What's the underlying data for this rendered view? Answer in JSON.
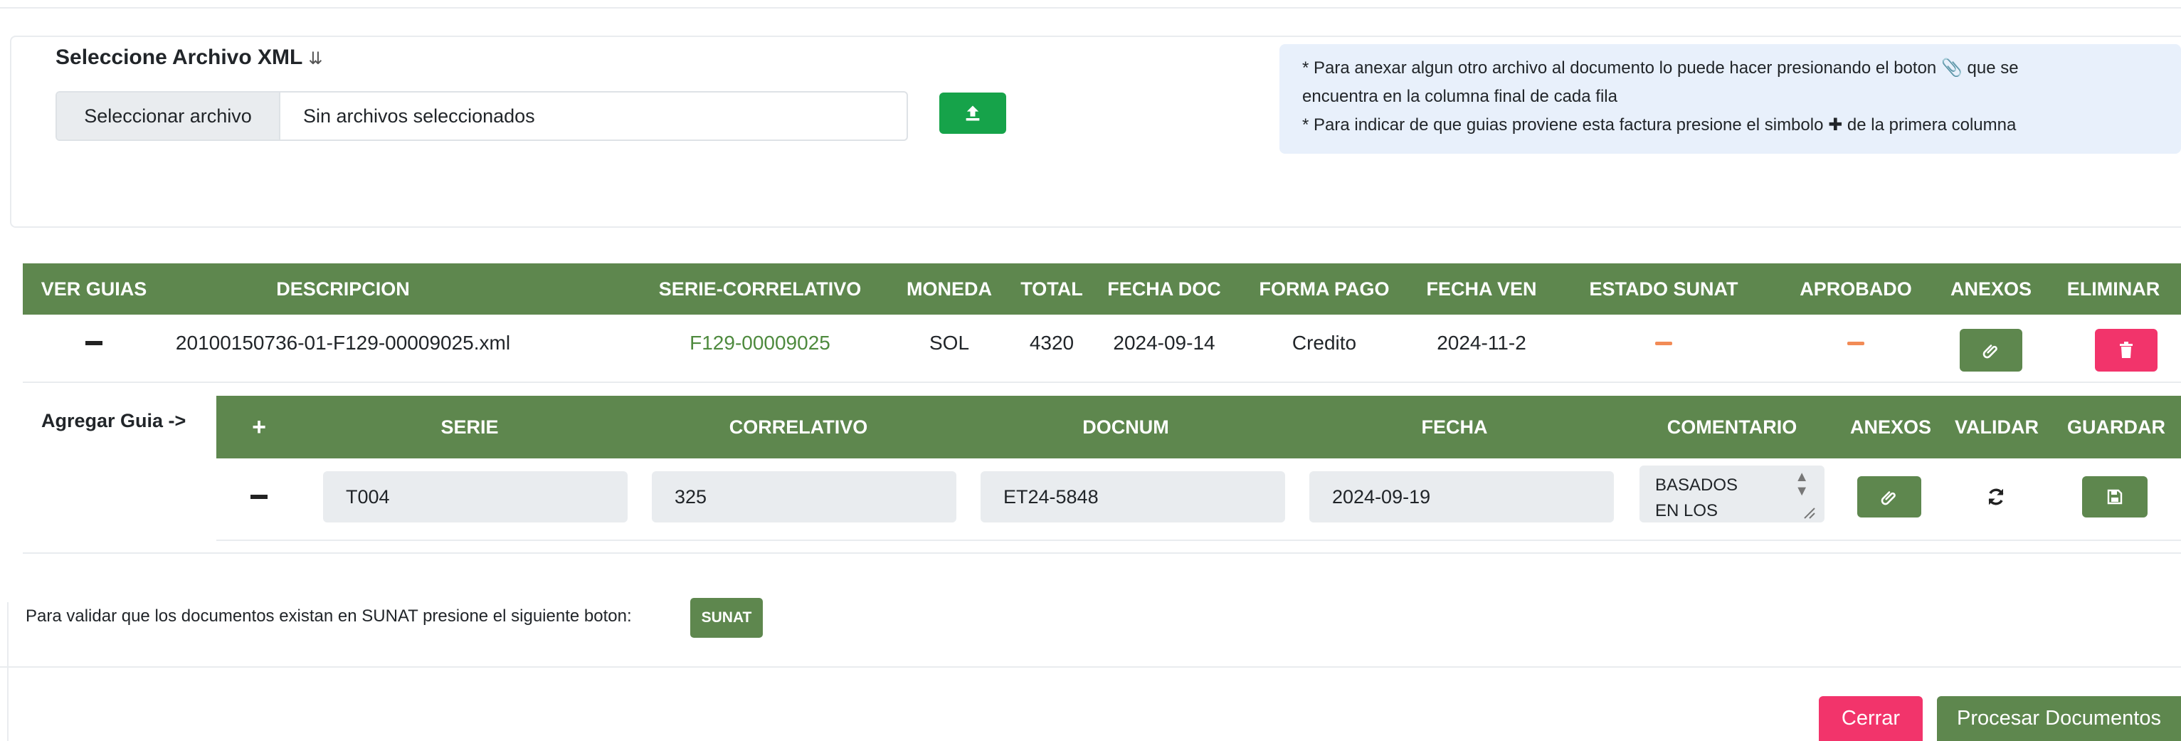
{
  "upload": {
    "title": "Seleccione Archivo XML",
    "title_chevron": "»",
    "choose_button": "Seleccionar archivo",
    "no_file_text": "Sin archivos seleccionados",
    "upload_icon": "upload-icon"
  },
  "info": {
    "line1_a": "* Para anexar algun otro archivo al documento lo puede hacer presionando el boton",
    "line1_b": "que se",
    "line2": "encuentra en la columna final de cada fila",
    "line3_a": "* Para indicar de que guias proviene esta factura presione el simbolo",
    "line3_b": "de la primera columna"
  },
  "main_table": {
    "headers": {
      "ver_guias": "VER GUIAS",
      "descripcion": "DESCRIPCION",
      "serie_correlativo": "SERIE-CORRELATIVO",
      "moneda": "MONEDA",
      "total": "TOTAL",
      "fecha_doc": "FECHA DOC",
      "forma_pago": "FORMA PAGO",
      "fecha_ven": "FECHA VEN",
      "estado_sunat": "ESTADO SUNAT",
      "aprobado": "APROBADO",
      "anexos": "ANEXOS",
      "eliminar": "ELIMINAR"
    },
    "row": {
      "descripcion": "20100150736-01-F129-00009025.xml",
      "serie_correlativo": "F129-00009025",
      "moneda": "SOL",
      "total": "4320",
      "fecha_doc": "2024-09-14",
      "forma_pago": "Credito",
      "fecha_ven": "2024-11-2"
    }
  },
  "guide_table": {
    "agregar_label": "Agregar Guia ->",
    "headers": {
      "add": "+",
      "serie": "SERIE",
      "correlativo": "CORRELATIVO",
      "docnum": "DOCNUM",
      "fecha": "FECHA",
      "comentario": "COMENTARIO",
      "anexos": "ANEXOS",
      "validar": "VALIDAR",
      "guardar": "GUARDAR"
    },
    "row": {
      "serie": "T004",
      "correlativo": "325",
      "docnum": "ET24-5848",
      "fecha": "2024-09-19",
      "comentario": "BASADOS EN LOS"
    }
  },
  "sunat": {
    "prompt": "Para validar que los documentos existan en SUNAT presione el siguiente boton:",
    "button": "SUNAT"
  },
  "footer": {
    "cerrar": "Cerrar",
    "procesar": "Procesar Documentos"
  },
  "colors": {
    "header_green": "#5e874e",
    "upload_green": "#16a34a",
    "danger_pink": "#f2346b",
    "info_bg": "#e8f0fb",
    "pending_orange": "#f28b56"
  }
}
